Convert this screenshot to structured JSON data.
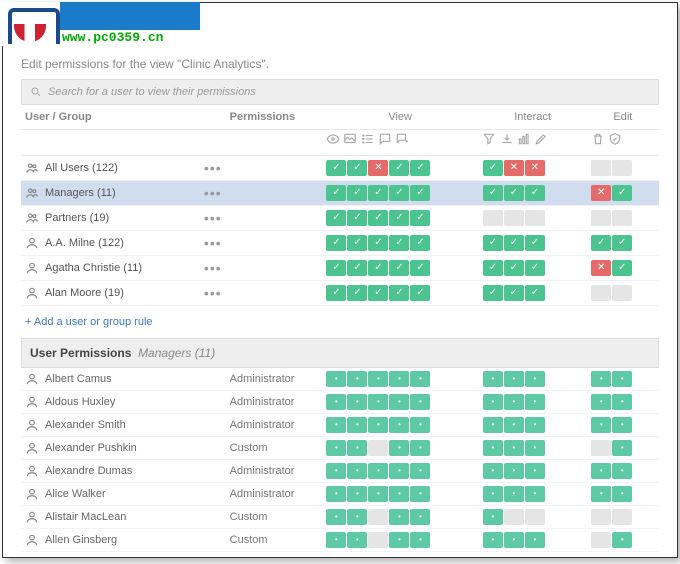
{
  "watermark_url": "www.pc0359.cn",
  "subtitle": "Edit permissions for the view \"Clinic Analytics\".",
  "search_placeholder": "Search for a user to view their permissions",
  "headers": {
    "user": "User / Group",
    "perm": "Permissions",
    "view": "View",
    "interact": "Interact",
    "edit": "Edit"
  },
  "add_rule": "+ Add a user or group rule",
  "section": {
    "title": "User Permissions",
    "group": "Managers (11)"
  },
  "rows": [
    {
      "icon": "group",
      "name": "All Users (122)",
      "selected": false,
      "view": [
        "g",
        "g",
        "r",
        "g",
        "g"
      ],
      "interact": [
        "g",
        "r",
        "r"
      ],
      "edit": [
        "e",
        "e"
      ]
    },
    {
      "icon": "group",
      "name": "Managers (11)",
      "selected": true,
      "view": [
        "g",
        "g",
        "g",
        "g",
        "g"
      ],
      "interact": [
        "g",
        "g",
        "g"
      ],
      "edit": [
        "r",
        "g"
      ]
    },
    {
      "icon": "group",
      "name": "Partners (19)",
      "selected": false,
      "view": [
        "g",
        "g",
        "g",
        "g",
        "g"
      ],
      "interact": [
        "e",
        "e",
        "e"
      ],
      "edit": [
        "e",
        "e"
      ]
    },
    {
      "icon": "user",
      "name": "A.A. Milne (122)",
      "selected": false,
      "view": [
        "g",
        "g",
        "g",
        "g",
        "g"
      ],
      "interact": [
        "g",
        "g",
        "g"
      ],
      "edit": [
        "g",
        "g"
      ]
    },
    {
      "icon": "user",
      "name": "Agatha Christie (11)",
      "selected": false,
      "view": [
        "g",
        "g",
        "g",
        "g",
        "g"
      ],
      "interact": [
        "g",
        "g",
        "g"
      ],
      "edit": [
        "r",
        "g"
      ]
    },
    {
      "icon": "user",
      "name": "Alan Moore (19)",
      "selected": false,
      "view": [
        "g",
        "g",
        "g",
        "g",
        "g"
      ],
      "interact": [
        "g",
        "g",
        "g"
      ],
      "edit": [
        "e",
        "e"
      ]
    }
  ],
  "detail_rows": [
    {
      "name": "Albert Camus",
      "role": "Administrator",
      "view": [
        "d",
        "d",
        "d",
        "d",
        "d"
      ],
      "interact": [
        "d",
        "d",
        "d"
      ],
      "edit": [
        "d",
        "d"
      ]
    },
    {
      "name": "Aldous Huxley",
      "role": "Administrator",
      "view": [
        "d",
        "d",
        "d",
        "d",
        "d"
      ],
      "interact": [
        "d",
        "d",
        "d"
      ],
      "edit": [
        "d",
        "d"
      ]
    },
    {
      "name": "Alexander Smith",
      "role": "Administrator",
      "view": [
        "d",
        "d",
        "d",
        "d",
        "d"
      ],
      "interact": [
        "d",
        "d",
        "d"
      ],
      "edit": [
        "d",
        "d"
      ]
    },
    {
      "name": "Alexander Pushkin",
      "role": "Custom",
      "view": [
        "d",
        "d",
        "de",
        "d",
        "d"
      ],
      "interact": [
        "d",
        "d",
        "d"
      ],
      "edit": [
        "de",
        "d"
      ]
    },
    {
      "name": "Alexandre Dumas",
      "role": "Administrator",
      "view": [
        "d",
        "d",
        "d",
        "d",
        "d"
      ],
      "interact": [
        "d",
        "d",
        "d"
      ],
      "edit": [
        "d",
        "d"
      ]
    },
    {
      "name": "Alice Walker",
      "role": "Administrator",
      "view": [
        "d",
        "d",
        "d",
        "d",
        "d"
      ],
      "interact": [
        "d",
        "d",
        "d"
      ],
      "edit": [
        "d",
        "d"
      ]
    },
    {
      "name": "Alistair MacLean",
      "role": "Custom",
      "view": [
        "d",
        "d",
        "de",
        "d",
        "d"
      ],
      "interact": [
        "d",
        "de",
        "de"
      ],
      "edit": [
        "de",
        "de"
      ]
    },
    {
      "name": "Allen Ginsberg",
      "role": "Custom",
      "view": [
        "d",
        "d",
        "de",
        "d",
        "d"
      ],
      "interact": [
        "d",
        "d",
        "d"
      ],
      "edit": [
        "de",
        "d"
      ]
    }
  ]
}
